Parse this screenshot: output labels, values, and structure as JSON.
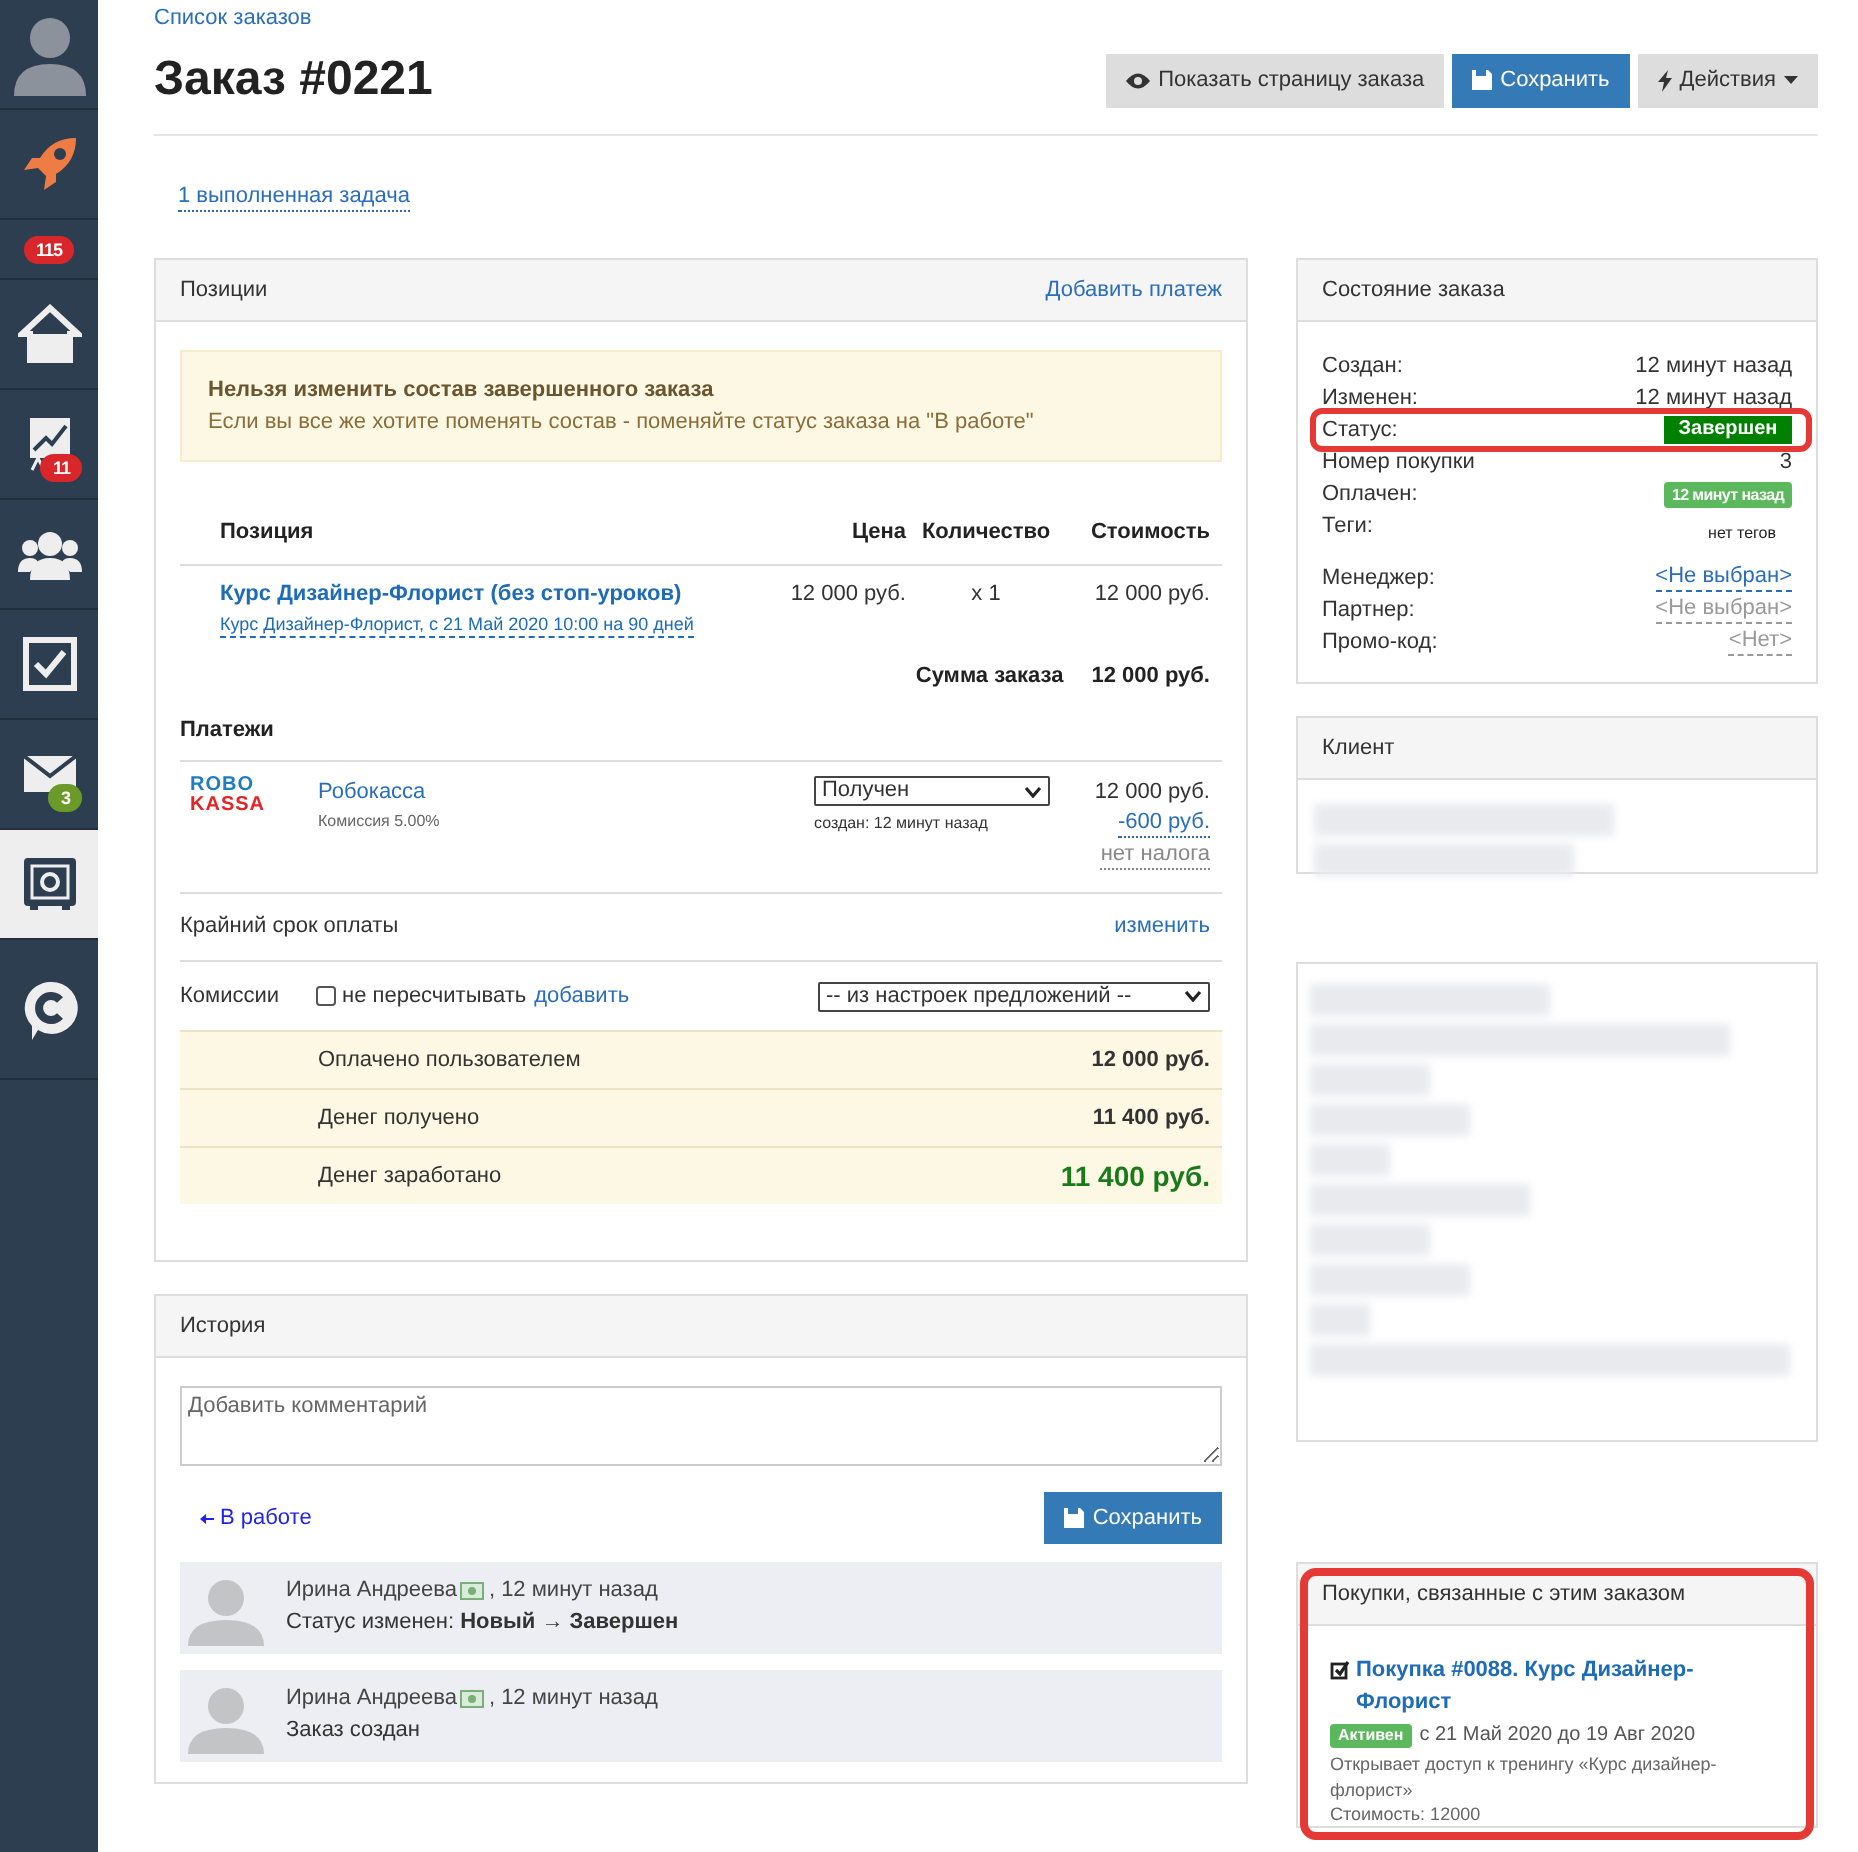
{
  "sidebar": {
    "items": [
      {
        "kind": "avatar",
        "selected": false
      },
      {
        "kind": "rocket",
        "selected": false
      },
      {
        "kind": "counter",
        "badge": "115",
        "color": "#d9262a",
        "selected": false
      },
      {
        "kind": "home",
        "selected": false
      },
      {
        "kind": "chart",
        "badge": "11",
        "color": "#d9262a",
        "selected": false
      },
      {
        "kind": "people",
        "selected": false
      },
      {
        "kind": "checkbox",
        "selected": false
      },
      {
        "kind": "mail",
        "badge": "3",
        "color": "#6a9a2a",
        "selected": false
      },
      {
        "kind": "safe",
        "selected": true
      },
      {
        "kind": "chat",
        "selected": false
      }
    ]
  },
  "breadcrumb": "Список заказов",
  "title": "Заказ #0221",
  "toolbar": [
    {
      "kind": "eye",
      "label": "Показать страницу заказа"
    },
    {
      "kind": "save",
      "label": "Сохранить"
    },
    {
      "kind": "actions",
      "label": "Действия"
    }
  ],
  "tasks_link": "1 выполненная задача",
  "positions": {
    "title": "Позиции",
    "action": "Добавить платеж",
    "alert": {
      "title": "Нельзя изменить состав завершенного заказа",
      "text": "Если вы все же хотите поменять состав - поменяйте статус заказа на \"В работе\""
    },
    "columns": [
      "Позиция",
      "Цена",
      "Количество",
      "Стоимость"
    ],
    "rows": [
      {
        "name": "Курс Дизайнер-Флорист (без стоп-уроков)",
        "details": "Курс Дизайнер-Флорист, с 21 Май 2020 10:00 на 90 дней",
        "price": "12 000 руб.",
        "quantity": "x 1",
        "cost": "12 000 руб."
      }
    ],
    "total_label": "Сумма заказа",
    "total": "12 000 руб.",
    "payments_title": "Платежи",
    "payments": [
      {
        "logo_top": "ROBO",
        "logo_bottom": "KASSA",
        "name": "Робокасса",
        "commission": "Комиссия 5.00%",
        "status": "Получен",
        "created": "создан: 12 минут назад",
        "amount": "12 000 руб.",
        "fee": "-600 руб.",
        "tax": "нет налога"
      }
    ],
    "deadline_label": "Крайний срок оплаты",
    "deadline_action": "изменить",
    "commissions_label": "Комиссии",
    "no_recalc": {
      "label": "не пересчитывать",
      "checked": false
    },
    "add_link": "добавить",
    "commission_source": "-- из настроек предложений --",
    "summary": [
      {
        "label": "Оплачено пользователем",
        "value": "12 000 руб.",
        "emphasis": false
      },
      {
        "label": "Денег получено",
        "value": "11 400 руб.",
        "emphasis": false
      },
      {
        "label": "Денег заработано",
        "value": "11 400 руб.",
        "emphasis": true
      }
    ]
  },
  "history": {
    "title": "История",
    "comment_placeholder": "Добавить комментарий",
    "back_link": "В работе",
    "save": "Сохранить",
    "entries": [
      {
        "author": "Ирина Андреева",
        "time": ", 12 минут назад",
        "text": "Статус изменен: **Новый → Завершен**"
      },
      {
        "author": "Ирина Андреева",
        "time": ", 12 минут назад",
        "text": "Заказ создан"
      }
    ]
  },
  "order_state": {
    "title": "Состояние заказа",
    "fields": [
      {
        "kind": "text",
        "label": "Создан:",
        "value": "12 минут назад",
        "highlighted": false
      },
      {
        "kind": "text",
        "label": "Изменен:",
        "value": "12 минут назад",
        "highlighted": false
      },
      {
        "kind": "status",
        "label": "Статус:",
        "value": "Завершен",
        "color": "#008000",
        "highlighted": true
      },
      {
        "kind": "text",
        "label": "Номер покупки",
        "value": "3",
        "highlighted": false
      },
      {
        "kind": "badge",
        "label": "Оплачен:",
        "value": "12 минут назад",
        "color": "#5cb85c",
        "highlighted": false
      },
      {
        "kind": "tags",
        "label": "Теги:",
        "value": "нет тегов",
        "highlighted": false
      },
      {
        "kind": "link",
        "label": "Менеджер:",
        "value": "<Не выбран>",
        "highlighted": false
      },
      {
        "kind": "muted_link",
        "label": "Партнер:",
        "value": "<Не выбран>",
        "highlighted": false
      },
      {
        "kind": "muted_link",
        "label": "Промо-код:",
        "value": "<Нет>",
        "highlighted": false
      }
    ]
  },
  "client": {
    "title": "Клиент",
    "redacted": true
  },
  "hidden_panel": {
    "redacted": true
  },
  "purchases": {
    "title": "Покупки, связанные с этим заказом",
    "highlighted": true,
    "items": [
      {
        "title": "Покупка #0088. Курс Дизайнер-Флорист",
        "status": "Активен",
        "period": "с 21 Май 2020 до 19 Авг 2020",
        "description": "Открывает доступ к тренингу «Курс дизайнер-флорист»",
        "cost": "Стоимость: 12000"
      }
    ]
  }
}
